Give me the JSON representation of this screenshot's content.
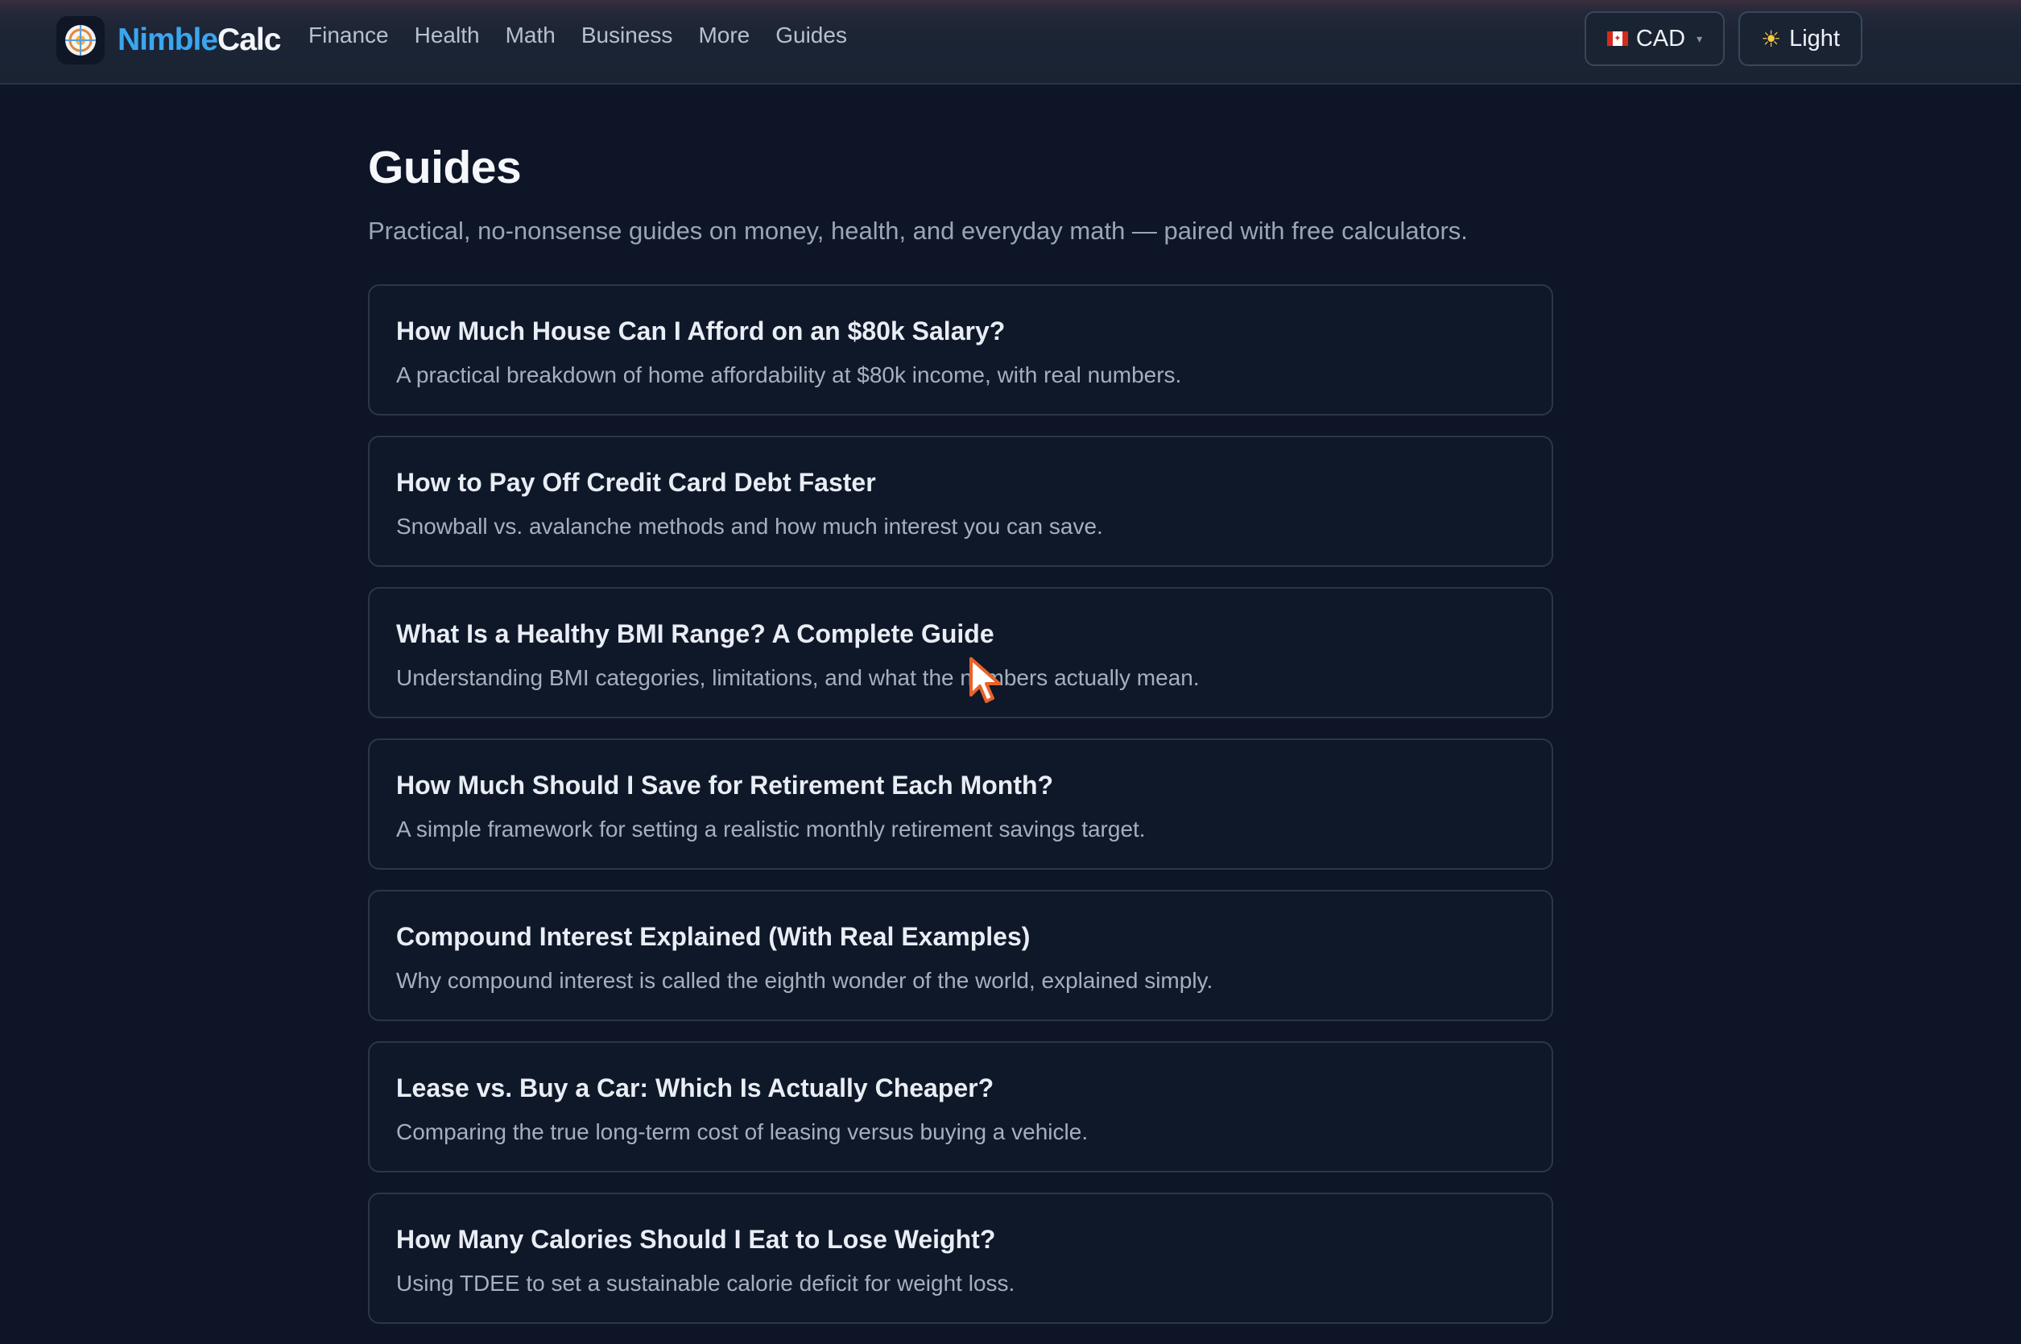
{
  "brand": {
    "name_part1": "Nimble",
    "name_part2": "Calc",
    "logo_icon": "globe-icon"
  },
  "nav": {
    "items": [
      {
        "label": "Finance"
      },
      {
        "label": "Health"
      },
      {
        "label": "Math"
      },
      {
        "label": "Business"
      },
      {
        "label": "More"
      },
      {
        "label": "Guides"
      }
    ]
  },
  "currency": {
    "label": "CAD",
    "flag_icon": "canada-flag-icon",
    "caret": "▾"
  },
  "theme": {
    "label": "Light",
    "icon": "sun-icon",
    "glyph": "☀"
  },
  "page": {
    "title": "Guides",
    "subtitle": "Practical, no-nonsense guides on money, health, and everyday math — paired with free calculators."
  },
  "guides": [
    {
      "title": "How Much House Can I Afford on an $80k Salary?",
      "description": "A practical breakdown of home affordability at $80k income, with real numbers."
    },
    {
      "title": "How to Pay Off Credit Card Debt Faster",
      "description": "Snowball vs. avalanche methods and how much interest you can save."
    },
    {
      "title": "What Is a Healthy BMI Range? A Complete Guide",
      "description": "Understanding BMI categories, limitations, and what the numbers actually mean."
    },
    {
      "title": "How Much Should I Save for Retirement Each Month?",
      "description": "A simple framework for setting a realistic monthly retirement savings target."
    },
    {
      "title": "Compound Interest Explained (With Real Examples)",
      "description": "Why compound interest is called the eighth wonder of the world, explained simply."
    },
    {
      "title": "Lease vs. Buy a Car: Which Is Actually Cheaper?",
      "description": "Comparing the true long-term cost of leasing versus buying a vehicle."
    },
    {
      "title": "How Many Calories Should I Eat to Lose Weight?",
      "description": "Using TDEE to set a sustainable calorie deficit for weight loss."
    }
  ],
  "colors": {
    "background": "#0d1526",
    "brand_blue": "#3aa6f0",
    "card_border": "#2c3649",
    "cursor_orange": "#e8622a"
  }
}
